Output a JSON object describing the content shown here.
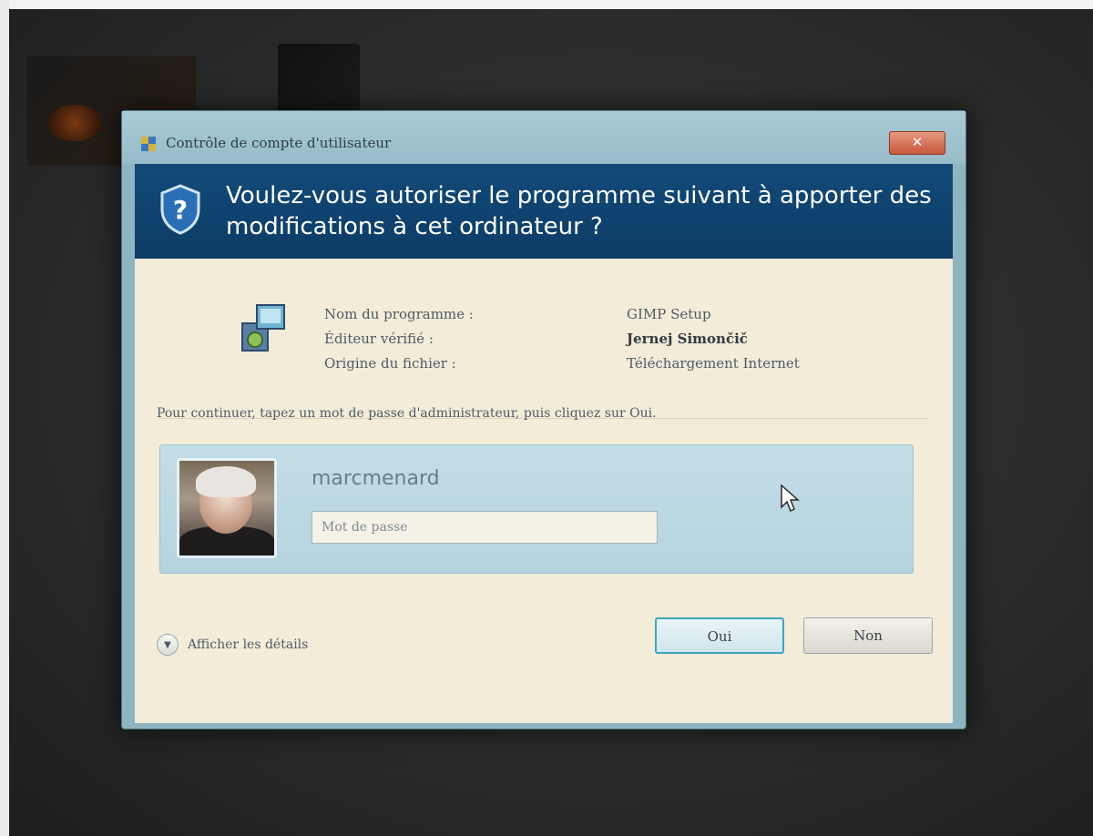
{
  "dialog": {
    "title": "Contrôle de compte d'utilisateur",
    "close_label": "✕",
    "question": "Voulez-vous autoriser le programme suivant à apporter des modifications à cet ordinateur ?"
  },
  "program_info": {
    "labels": {
      "name": "Nom du programme :",
      "publisher": "Éditeur vérifié :",
      "origin": "Origine du fichier :"
    },
    "values": {
      "name": "GIMP Setup",
      "publisher": "Jernej Simončič",
      "origin": "Téléchargement Internet"
    }
  },
  "credentials": {
    "instruction": "Pour continuer, tapez un mot de passe d'administrateur, puis cliquez sur Oui.",
    "username": "marcmenard",
    "password_placeholder": "Mot de passe",
    "password_value": ""
  },
  "footer": {
    "details_label": "Afficher les détails",
    "yes_label": "Oui",
    "no_label": "Non"
  },
  "icons": {
    "title": "uac-shield-icon",
    "banner": "question-shield-icon",
    "program": "installer-icon",
    "details": "chevron-down-icon",
    "cursor": "mouse-pointer-icon"
  },
  "colors": {
    "banner": "#124a78",
    "content": "#f2ecd8",
    "frame": "#8fb4c2",
    "credential_panel": "#c3dde7",
    "default_button_border": "#3fa5bf"
  }
}
